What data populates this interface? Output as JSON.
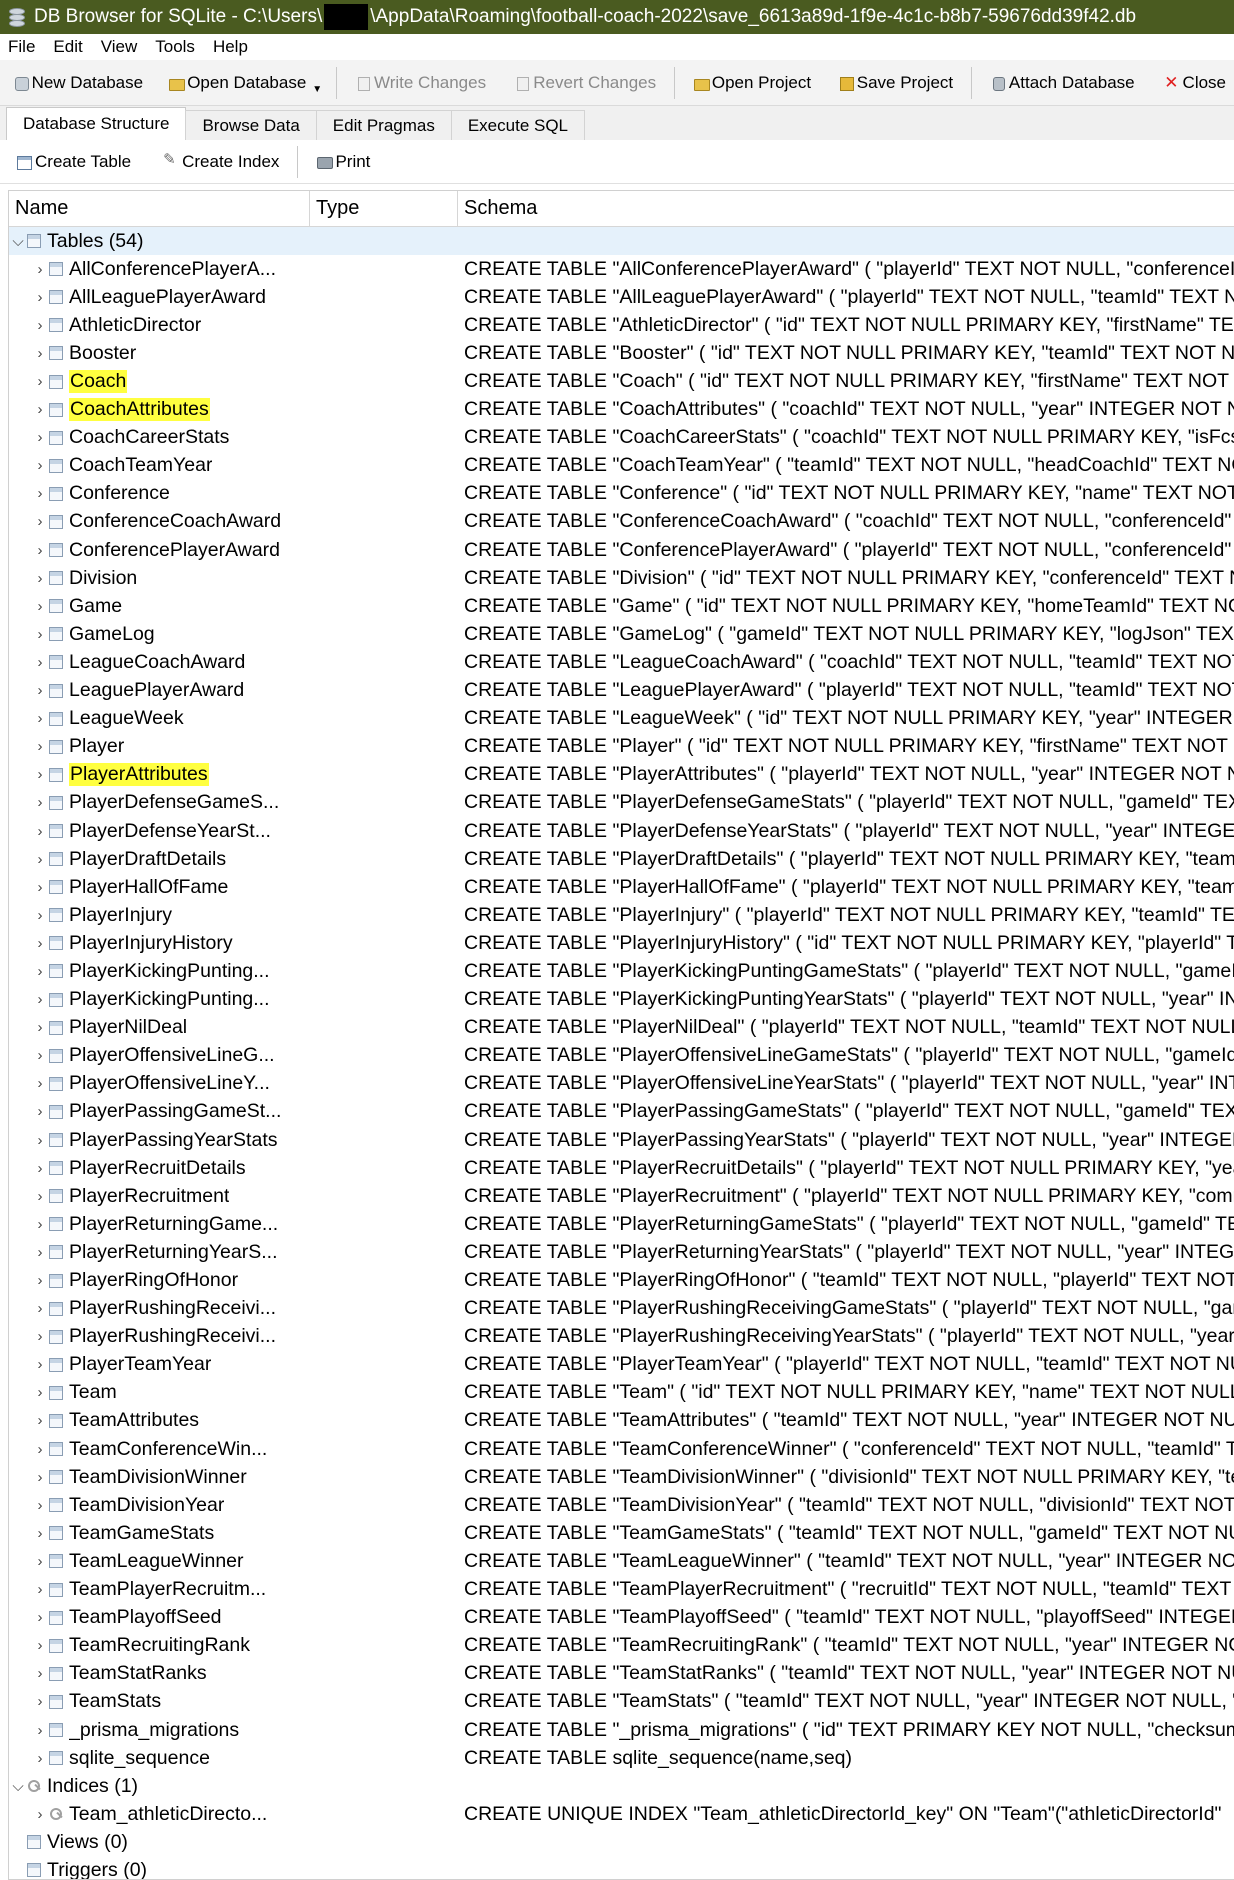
{
  "window": {
    "title_prefix": "DB Browser for SQLite - C:\\Users\\",
    "title_suffix": "\\AppData\\Roaming\\football-coach-2022\\save_6613a89d-1f9e-4c1c-b8b7-59676dd39f42.db"
  },
  "menu": [
    "File",
    "Edit",
    "View",
    "Tools",
    "Help"
  ],
  "toolbar": {
    "new_database": "New Database",
    "open_database": "Open Database",
    "write_changes": "Write Changes",
    "revert_changes": "Revert Changes",
    "open_project": "Open Project",
    "save_project": "Save Project",
    "attach_database": "Attach Database",
    "close": "Close"
  },
  "tabs": [
    "Database Structure",
    "Browse Data",
    "Edit Pragmas",
    "Execute SQL"
  ],
  "subtoolbar": {
    "create_table": "Create Table",
    "create_index": "Create Index",
    "print": "Print"
  },
  "columns": {
    "name": "Name",
    "type": "Type",
    "schema": "Schema"
  },
  "groups": {
    "tables": "Tables (54)",
    "indices": "Indices (1)",
    "views": "Views (0)",
    "triggers": "Triggers (0)"
  },
  "highlight_color": "#ffff40",
  "tables": [
    {
      "name": "AllConferencePlayerA...",
      "schema": "CREATE TABLE \"AllConferencePlayerAward\" ( \"playerId\" TEXT NOT NULL, \"conferenceI"
    },
    {
      "name": "AllLeaguePlayerAward",
      "schema": "CREATE TABLE \"AllLeaguePlayerAward\" ( \"playerId\" TEXT NOT NULL, \"teamId\" TEXT N"
    },
    {
      "name": "AthleticDirector",
      "schema": "CREATE TABLE \"AthleticDirector\" ( \"id\" TEXT NOT NULL PRIMARY KEY, \"firstName\" TEX"
    },
    {
      "name": "Booster",
      "schema": "CREATE TABLE \"Booster\" ( \"id\" TEXT NOT NULL PRIMARY KEY, \"teamId\" TEXT NOT NU"
    },
    {
      "name": "Coach",
      "highlighted": true,
      "schema": "CREATE TABLE \"Coach\" ( \"id\" TEXT NOT NULL PRIMARY KEY, \"firstName\" TEXT NOT NU"
    },
    {
      "name": "CoachAttributes",
      "highlighted": true,
      "schema": "CREATE TABLE \"CoachAttributes\" ( \"coachId\" TEXT NOT NULL, \"year\" INTEGER NOT N"
    },
    {
      "name": "CoachCareerStats",
      "schema": "CREATE TABLE \"CoachCareerStats\" ( \"coachId\" TEXT NOT NULL PRIMARY KEY, \"isFcs\""
    },
    {
      "name": "CoachTeamYear",
      "schema": "CREATE TABLE \"CoachTeamYear\" ( \"teamId\" TEXT NOT NULL, \"headCoachId\" TEXT NO"
    },
    {
      "name": "Conference",
      "schema": "CREATE TABLE \"Conference\" ( \"id\" TEXT NOT NULL PRIMARY KEY, \"name\" TEXT NOT N"
    },
    {
      "name": "ConferenceCoachAward",
      "schema": "CREATE TABLE \"ConferenceCoachAward\" ( \"coachId\" TEXT NOT NULL, \"conferenceId\""
    },
    {
      "name": "ConferencePlayerAward",
      "schema": "CREATE TABLE \"ConferencePlayerAward\" ( \"playerId\" TEXT NOT NULL, \"conferenceId\""
    },
    {
      "name": "Division",
      "schema": "CREATE TABLE \"Division\" ( \"id\" TEXT NOT NULL PRIMARY KEY, \"conferenceId\" TEXT N"
    },
    {
      "name": "Game",
      "schema": "CREATE TABLE \"Game\" ( \"id\" TEXT NOT NULL PRIMARY KEY, \"homeTeamId\" TEXT NO"
    },
    {
      "name": "GameLog",
      "schema": "CREATE TABLE \"GameLog\" ( \"gameId\" TEXT NOT NULL PRIMARY KEY, \"logJson\" TEXT"
    },
    {
      "name": "LeagueCoachAward",
      "schema": "CREATE TABLE \"LeagueCoachAward\" ( \"coachId\" TEXT NOT NULL, \"teamId\" TEXT NOT"
    },
    {
      "name": "LeaguePlayerAward",
      "schema": "CREATE TABLE \"LeaguePlayerAward\" ( \"playerId\" TEXT NOT NULL, \"teamId\" TEXT NOT"
    },
    {
      "name": "LeagueWeek",
      "schema": "CREATE TABLE \"LeagueWeek\" ( \"id\" TEXT NOT NULL PRIMARY KEY, \"year\" INTEGER N"
    },
    {
      "name": "Player",
      "schema": "CREATE TABLE \"Player\" ( \"id\" TEXT NOT NULL PRIMARY KEY, \"firstName\" TEXT NOT NU"
    },
    {
      "name": "PlayerAttributes",
      "highlighted": true,
      "schema": "CREATE TABLE \"PlayerAttributes\" ( \"playerId\" TEXT NOT NULL, \"year\" INTEGER NOT N"
    },
    {
      "name": "PlayerDefenseGameS...",
      "schema": "CREATE TABLE \"PlayerDefenseGameStats\" ( \"playerId\" TEXT NOT NULL, \"gameId\" TEX"
    },
    {
      "name": "PlayerDefenseYearSt...",
      "schema": "CREATE TABLE \"PlayerDefenseYearStats\" ( \"playerId\" TEXT NOT NULL, \"year\" INTEGER"
    },
    {
      "name": "PlayerDraftDetails",
      "schema": "CREATE TABLE \"PlayerDraftDetails\" ( \"playerId\" TEXT NOT NULL PRIMARY KEY, \"team"
    },
    {
      "name": "PlayerHallOfFame",
      "schema": "CREATE TABLE \"PlayerHallOfFame\" ( \"playerId\" TEXT NOT NULL PRIMARY KEY, \"teamI"
    },
    {
      "name": "PlayerInjury",
      "schema": "CREATE TABLE \"PlayerInjury\" ( \"playerId\" TEXT NOT NULL PRIMARY KEY, \"teamId\" TE"
    },
    {
      "name": "PlayerInjuryHistory",
      "schema": "CREATE TABLE \"PlayerInjuryHistory\" ( \"id\" TEXT NOT NULL PRIMARY KEY, \"playerId\" T"
    },
    {
      "name": "PlayerKickingPunting...",
      "schema": "CREATE TABLE \"PlayerKickingPuntingGameStats\" ( \"playerId\" TEXT NOT NULL, \"gameI"
    },
    {
      "name": "PlayerKickingPunting...",
      "schema": "CREATE TABLE \"PlayerKickingPuntingYearStats\" ( \"playerId\" TEXT NOT NULL, \"year\" IN"
    },
    {
      "name": "PlayerNilDeal",
      "schema": "CREATE TABLE \"PlayerNilDeal\" ( \"playerId\" TEXT NOT NULL, \"teamId\" TEXT NOT NULL"
    },
    {
      "name": "PlayerOffensiveLineG...",
      "schema": "CREATE TABLE \"PlayerOffensiveLineGameStats\" ( \"playerId\" TEXT NOT NULL, \"gameId"
    },
    {
      "name": "PlayerOffensiveLineY...",
      "schema": "CREATE TABLE \"PlayerOffensiveLineYearStats\" ( \"playerId\" TEXT NOT NULL, \"year\" INT"
    },
    {
      "name": "PlayerPassingGameSt...",
      "schema": "CREATE TABLE \"PlayerPassingGameStats\" ( \"playerId\" TEXT NOT NULL, \"gameId\" TEX"
    },
    {
      "name": "PlayerPassingYearStats",
      "schema": "CREATE TABLE \"PlayerPassingYearStats\" ( \"playerId\" TEXT NOT NULL, \"year\" INTEGER"
    },
    {
      "name": "PlayerRecruitDetails",
      "schema": "CREATE TABLE \"PlayerRecruitDetails\" ( \"playerId\" TEXT NOT NULL PRIMARY KEY, \"yea"
    },
    {
      "name": "PlayerRecruitment",
      "schema": "CREATE TABLE \"PlayerRecruitment\" ( \"playerId\" TEXT NOT NULL PRIMARY KEY, \"comm"
    },
    {
      "name": "PlayerReturningGame...",
      "schema": "CREATE TABLE \"PlayerReturningGameStats\" ( \"playerId\" TEXT NOT NULL, \"gameId\" TE"
    },
    {
      "name": "PlayerReturningYearS...",
      "schema": "CREATE TABLE \"PlayerReturningYearStats\" ( \"playerId\" TEXT NOT NULL, \"year\" INTEG"
    },
    {
      "name": "PlayerRingOfHonor",
      "schema": "CREATE TABLE \"PlayerRingOfHonor\" ( \"teamId\" TEXT NOT NULL, \"playerId\" TEXT NOT"
    },
    {
      "name": "PlayerRushingReceivi...",
      "schema": "CREATE TABLE \"PlayerRushingReceivingGameStats\" ( \"playerId\" TEXT NOT NULL, \"gam"
    },
    {
      "name": "PlayerRushingReceivi...",
      "schema": "CREATE TABLE \"PlayerRushingReceivingYearStats\" ( \"playerId\" TEXT NOT NULL, \"year\""
    },
    {
      "name": "PlayerTeamYear",
      "schema": "CREATE TABLE \"PlayerTeamYear\" ( \"playerId\" TEXT NOT NULL, \"teamId\" TEXT NOT NU"
    },
    {
      "name": "Team",
      "schema": "CREATE TABLE \"Team\" ( \"id\" TEXT NOT NULL PRIMARY KEY, \"name\" TEXT NOT NULL,"
    },
    {
      "name": "TeamAttributes",
      "schema": "CREATE TABLE \"TeamAttributes\" ( \"teamId\" TEXT NOT NULL, \"year\" INTEGER NOT NU"
    },
    {
      "name": "TeamConferenceWin...",
      "schema": "CREATE TABLE \"TeamConferenceWinner\" ( \"conferenceId\" TEXT NOT NULL, \"teamId\" T"
    },
    {
      "name": "TeamDivisionWinner",
      "schema": "CREATE TABLE \"TeamDivisionWinner\" ( \"divisionId\" TEXT NOT NULL PRIMARY KEY, \"te"
    },
    {
      "name": "TeamDivisionYear",
      "schema": "CREATE TABLE \"TeamDivisionYear\" ( \"teamId\" TEXT NOT NULL, \"divisionId\" TEXT NOT"
    },
    {
      "name": "TeamGameStats",
      "schema": "CREATE TABLE \"TeamGameStats\" ( \"teamId\" TEXT NOT NULL, \"gameId\" TEXT NOT NU"
    },
    {
      "name": "TeamLeagueWinner",
      "schema": "CREATE TABLE \"TeamLeagueWinner\" ( \"teamId\" TEXT NOT NULL, \"year\" INTEGER NOT"
    },
    {
      "name": "TeamPlayerRecruitm...",
      "schema": "CREATE TABLE \"TeamPlayerRecruitment\" ( \"recruitId\" TEXT NOT NULL, \"teamId\" TEXT"
    },
    {
      "name": "TeamPlayoffSeed",
      "schema": "CREATE TABLE \"TeamPlayoffSeed\" ( \"teamId\" TEXT NOT NULL, \"playoffSeed\" INTEGER"
    },
    {
      "name": "TeamRecruitingRank",
      "schema": "CREATE TABLE \"TeamRecruitingRank\" ( \"teamId\" TEXT NOT NULL, \"year\" INTEGER NO"
    },
    {
      "name": "TeamStatRanks",
      "schema": "CREATE TABLE \"TeamStatRanks\" ( \"teamId\" TEXT NOT NULL, \"year\" INTEGER NOT NU"
    },
    {
      "name": "TeamStats",
      "schema": "CREATE TABLE \"TeamStats\" ( \"teamId\" TEXT NOT NULL, \"year\" INTEGER NOT NULL, \""
    },
    {
      "name": "_prisma_migrations",
      "schema": "CREATE TABLE \"_prisma_migrations\" ( \"id\" TEXT PRIMARY KEY NOT NULL, \"checksum\""
    },
    {
      "name": "sqlite_sequence",
      "schema": "CREATE TABLE sqlite_sequence(name,seq)"
    }
  ],
  "indices": [
    {
      "name": "Team_athleticDirecto...",
      "schema": "CREATE UNIQUE INDEX \"Team_athleticDirectorId_key\" ON \"Team\"(\"athleticDirectorId\""
    }
  ]
}
